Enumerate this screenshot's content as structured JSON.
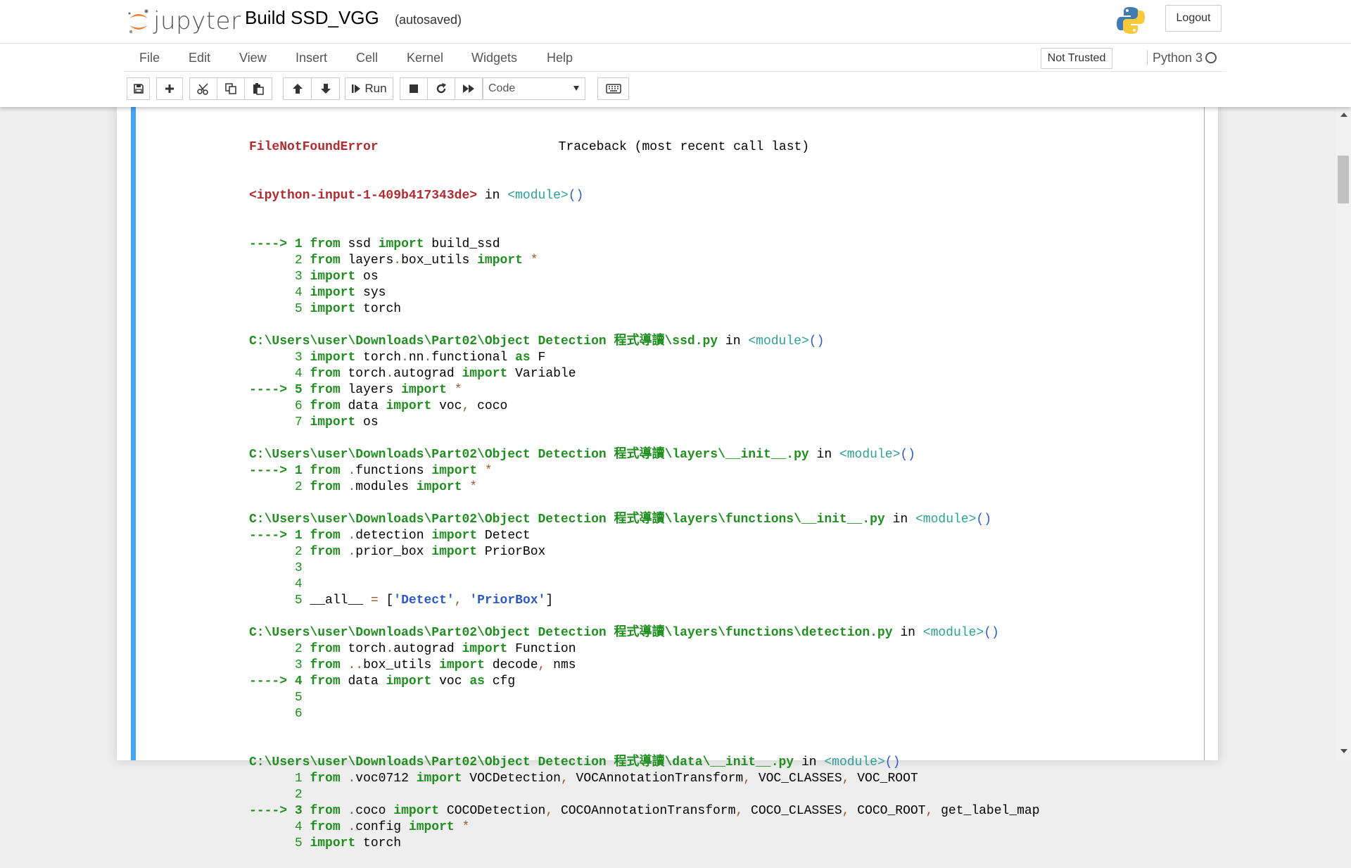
{
  "header": {
    "logo_text": "jupyter",
    "notebook_title": "Build SSD_VGG",
    "autosave_status": "(autosaved)",
    "logout_label": "Logout"
  },
  "menubar": {
    "items": [
      "File",
      "Edit",
      "View",
      "Insert",
      "Cell",
      "Kernel",
      "Widgets",
      "Help"
    ],
    "trust_status": "Not Trusted",
    "kernel_name": "Python 3"
  },
  "toolbar": {
    "run_label": "Run",
    "cell_type": "Code"
  },
  "traceback": {
    "error_type": "FileNotFoundError",
    "header_right": "Traceback (most recent call last)",
    "input_name": "<ipython-input-1-409b417343de>",
    "in_word": "in",
    "module_label": "<module>",
    "module_parens": "()",
    "arrow": "---->",
    "frames": [
      {
        "lines": [
          {
            "n": "1",
            "arrow": true,
            "parts": [
              [
                "kw",
                "from"
              ],
              [
                "t",
                " ssd "
              ],
              [
                "kw",
                "import"
              ],
              [
                "t",
                " build_ssd"
              ]
            ]
          },
          {
            "n": "2",
            "parts": [
              [
                "kw",
                "from"
              ],
              [
                "t",
                " layers"
              ],
              [
                "op",
                "."
              ],
              [
                "t",
                "box_utils "
              ],
              [
                "kw",
                "import"
              ],
              [
                "op",
                " *"
              ]
            ]
          },
          {
            "n": "3",
            "parts": [
              [
                "kw",
                "import"
              ],
              [
                "t",
                " os"
              ]
            ]
          },
          {
            "n": "4",
            "parts": [
              [
                "kw",
                "import"
              ],
              [
                "t",
                " sys"
              ]
            ]
          },
          {
            "n": "5",
            "parts": [
              [
                "kw",
                "import"
              ],
              [
                "t",
                " torch"
              ]
            ]
          }
        ]
      },
      {
        "path": "C:\\Users\\user\\Downloads\\Part02\\Object Detection 程式導讀\\ssd.py",
        "lines": [
          {
            "n": "3",
            "parts": [
              [
                "kw",
                "import"
              ],
              [
                "t",
                " torch"
              ],
              [
                "op",
                "."
              ],
              [
                "t",
                "nn"
              ],
              [
                "op",
                "."
              ],
              [
                "t",
                "functional "
              ],
              [
                "kw",
                "as"
              ],
              [
                "t",
                " F"
              ]
            ]
          },
          {
            "n": "4",
            "parts": [
              [
                "kw",
                "from"
              ],
              [
                "t",
                " torch"
              ],
              [
                "op",
                "."
              ],
              [
                "t",
                "autograd "
              ],
              [
                "kw",
                "import"
              ],
              [
                "t",
                " Variable"
              ]
            ]
          },
          {
            "n": "5",
            "arrow": true,
            "parts": [
              [
                "kw",
                "from"
              ],
              [
                "t",
                " layers "
              ],
              [
                "kw",
                "import"
              ],
              [
                "op",
                " *"
              ]
            ]
          },
          {
            "n": "6",
            "parts": [
              [
                "kw",
                "from"
              ],
              [
                "t",
                " data "
              ],
              [
                "kw",
                "import"
              ],
              [
                "t",
                " voc"
              ],
              [
                "op",
                ","
              ],
              [
                "t",
                " coco"
              ]
            ]
          },
          {
            "n": "7",
            "parts": [
              [
                "kw",
                "import"
              ],
              [
                "t",
                " os"
              ]
            ]
          }
        ]
      },
      {
        "path": "C:\\Users\\user\\Downloads\\Part02\\Object Detection 程式導讀\\layers\\__init__.py",
        "lines": [
          {
            "n": "1",
            "arrow": true,
            "parts": [
              [
                "kw",
                "from"
              ],
              [
                "op",
                " ."
              ],
              [
                "t",
                "functions "
              ],
              [
                "kw",
                "import"
              ],
              [
                "op",
                " *"
              ]
            ]
          },
          {
            "n": "2",
            "parts": [
              [
                "kw",
                "from"
              ],
              [
                "op",
                " ."
              ],
              [
                "t",
                "modules "
              ],
              [
                "kw",
                "import"
              ],
              [
                "op",
                " *"
              ]
            ]
          }
        ]
      },
      {
        "path": "C:\\Users\\user\\Downloads\\Part02\\Object Detection 程式導讀\\layers\\functions\\__init__.py",
        "lines": [
          {
            "n": "1",
            "arrow": true,
            "parts": [
              [
                "kw",
                "from"
              ],
              [
                "op",
                " ."
              ],
              [
                "t",
                "detection "
              ],
              [
                "kw",
                "import"
              ],
              [
                "t",
                " Detect"
              ]
            ]
          },
          {
            "n": "2",
            "parts": [
              [
                "kw",
                "from"
              ],
              [
                "op",
                " ."
              ],
              [
                "t",
                "prior_box "
              ],
              [
                "kw",
                "import"
              ],
              [
                "t",
                " PriorBox"
              ]
            ]
          },
          {
            "n": "3",
            "parts": []
          },
          {
            "n": "4",
            "parts": []
          },
          {
            "n": "5",
            "parts": [
              [
                "t",
                "__all__ "
              ],
              [
                "op",
                "="
              ],
              [
                "t",
                " ["
              ],
              [
                "str",
                "'Detect'"
              ],
              [
                "op",
                ","
              ],
              [
                "t",
                " "
              ],
              [
                "str",
                "'PriorBox'"
              ],
              [
                "t",
                "]"
              ]
            ]
          }
        ]
      },
      {
        "path": "C:\\Users\\user\\Downloads\\Part02\\Object Detection 程式導讀\\layers\\functions\\detection.py",
        "lines": [
          {
            "n": "2",
            "parts": [
              [
                "kw",
                "from"
              ],
              [
                "t",
                " torch"
              ],
              [
                "op",
                "."
              ],
              [
                "t",
                "autograd "
              ],
              [
                "kw",
                "import"
              ],
              [
                "t",
                " Function"
              ]
            ]
          },
          {
            "n": "3",
            "parts": [
              [
                "kw",
                "from"
              ],
              [
                "op",
                " .."
              ],
              [
                "t",
                "box_utils "
              ],
              [
                "kw",
                "import"
              ],
              [
                "t",
                " decode"
              ],
              [
                "op",
                ","
              ],
              [
                "t",
                " nms"
              ]
            ]
          },
          {
            "n": "4",
            "arrow": true,
            "parts": [
              [
                "kw",
                "from"
              ],
              [
                "t",
                " data "
              ],
              [
                "kw",
                "import"
              ],
              [
                "t",
                " voc "
              ],
              [
                "kw",
                "as"
              ],
              [
                "t",
                " cfg"
              ]
            ]
          },
          {
            "n": "5",
            "parts": []
          },
          {
            "n": "6",
            "parts": []
          }
        ]
      },
      {
        "path": "C:\\Users\\user\\Downloads\\Part02\\Object Detection 程式導讀\\data\\__init__.py",
        "blank_before": true,
        "lines": [
          {
            "n": "1",
            "parts": [
              [
                "kw",
                "from"
              ],
              [
                "op",
                " ."
              ],
              [
                "t",
                "voc0712 "
              ],
              [
                "kw",
                "import"
              ],
              [
                "t",
                " VOCDetection"
              ],
              [
                "op",
                ","
              ],
              [
                "t",
                " VOCAnnotationTransform"
              ],
              [
                "op",
                ","
              ],
              [
                "t",
                " VOC_CLASSES"
              ],
              [
                "op",
                ","
              ],
              [
                "t",
                " VOC_ROOT"
              ]
            ]
          },
          {
            "n": "2",
            "parts": []
          },
          {
            "n": "3",
            "arrow": true,
            "parts": [
              [
                "kw",
                "from"
              ],
              [
                "op",
                " ."
              ],
              [
                "t",
                "coco "
              ],
              [
                "kw",
                "import"
              ],
              [
                "t",
                " COCODetection"
              ],
              [
                "op",
                ","
              ],
              [
                "t",
                " COCOAnnotationTransform"
              ],
              [
                "op",
                ","
              ],
              [
                "t",
                " COCO_CLASSES"
              ],
              [
                "op",
                ","
              ],
              [
                "t",
                " COCO_ROOT"
              ],
              [
                "op",
                ","
              ],
              [
                "t",
                " get_label_map"
              ]
            ]
          },
          {
            "n": "4",
            "parts": [
              [
                "kw",
                "from"
              ],
              [
                "op",
                " ."
              ],
              [
                "t",
                "config "
              ],
              [
                "kw",
                "import"
              ],
              [
                "op",
                " *"
              ]
            ]
          },
          {
            "n": "5",
            "parts": [
              [
                "kw",
                "import"
              ],
              [
                "t",
                " torch"
              ]
            ]
          }
        ]
      }
    ]
  }
}
